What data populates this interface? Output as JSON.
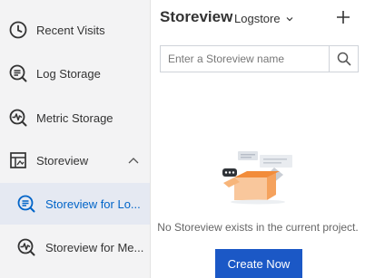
{
  "sidebar": {
    "items": [
      {
        "label": "Recent Visits",
        "icon": "clock-icon"
      },
      {
        "label": "Log Storage",
        "icon": "log-search-icon"
      },
      {
        "label": "Metric Storage",
        "icon": "metric-icon"
      },
      {
        "label": "Storeview",
        "icon": "storeview-icon",
        "expanded": true
      },
      {
        "label": "Storeview for Lo...",
        "icon": "log-search-icon",
        "active": true
      },
      {
        "label": "Storeview for Me...",
        "icon": "metric-icon"
      }
    ]
  },
  "main": {
    "title": "Storeview",
    "dropdown_label": "Logstore",
    "search_placeholder": "Enter a Storeview name",
    "empty_message": "No Storeview exists in the current project.",
    "create_label": "Create Now"
  },
  "colors": {
    "accent": "#1b58c6",
    "active_text": "#0064c8",
    "sidebar_bg": "#f3f3f4",
    "active_bg": "#e5e9f2",
    "illustration_orange": "#f5a25d"
  }
}
